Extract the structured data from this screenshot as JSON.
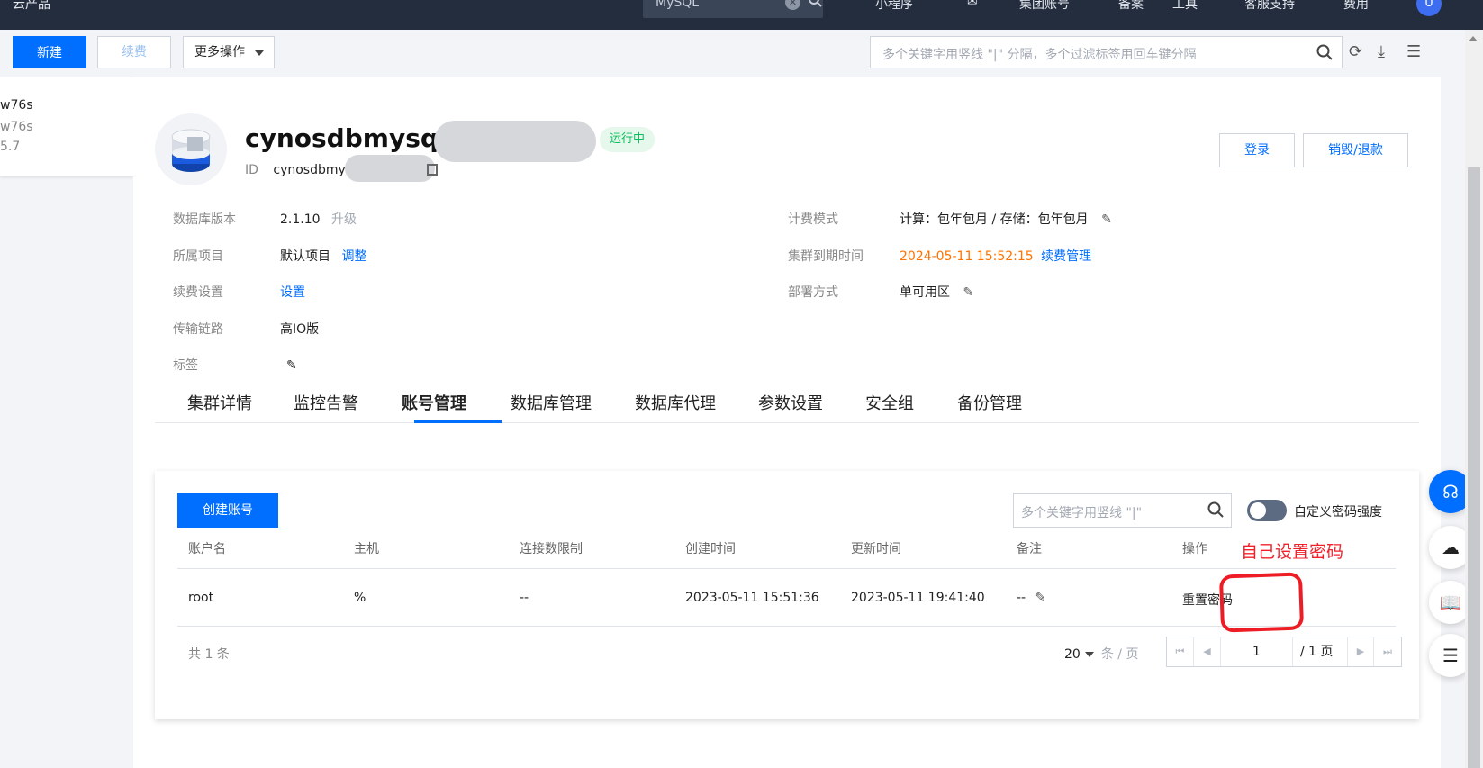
{
  "topbar": {
    "products": "云产品",
    "search_value": "MySQL",
    "items": [
      "小程序",
      "集团账号",
      "备案",
      "工具",
      "客服支持",
      "费用"
    ],
    "avatar": "U"
  },
  "toolbar": {
    "new_label": "新建",
    "renew_label": "续费",
    "more_label": "更多操作",
    "filter_placeholder": "多个关键字用竖线 \"|\" 分隔，多个过滤标签用回车键分隔"
  },
  "left_list": {
    "line1": "w76s",
    "line2": "w76s",
    "line3": "5.7"
  },
  "cluster": {
    "name": "cynosdbmysql",
    "status": "运行中",
    "id_label": "ID",
    "id_value": "cynosdbmysq",
    "login_label": "登录",
    "destroy_label": "销毁/退款"
  },
  "details": {
    "db_version_label": "数据库版本",
    "db_version_value": "2.1.10",
    "upgrade_label": "升级",
    "project_label": "所属项目",
    "project_value": "默认项目",
    "adjust_label": "调整",
    "renew_setting_label": "续费设置",
    "renew_setting_link": "设置",
    "link_label": "传输链路",
    "link_value": "高IO版",
    "tag_label": "标签",
    "billing_label": "计费模式",
    "billing_value": "计算：包年包月 / 存储：包年包月",
    "expire_label": "集群到期时间",
    "expire_value": "2024-05-11 15:52:15",
    "renew_manage_label": "续费管理",
    "deploy_label": "部署方式",
    "deploy_value": "单可用区"
  },
  "tabs": [
    "集群详情",
    "监控告警",
    "账号管理",
    "数据库管理",
    "数据库代理",
    "参数设置",
    "安全组",
    "备份管理"
  ],
  "accounts": {
    "create_label": "创建账号",
    "search_placeholder": "多个关键字用竖线 \"|\"",
    "toggle_label": "自定义密码强度",
    "columns": [
      "账户名",
      "主机",
      "连接数限制",
      "创建时间",
      "更新时间",
      "备注",
      "操作"
    ],
    "rows": [
      {
        "name": "root",
        "host": "%",
        "conn_limit": "--",
        "created": "2023-05-11 15:51:36",
        "updated": "2023-05-11 19:41:40",
        "note": "--",
        "action": "重置密码"
      }
    ],
    "annotation": "自己设置密码",
    "total": "共 1 条",
    "page_size": "20",
    "page_size_unit": "条 / 页",
    "page": "1",
    "page_total": "/ 1 页"
  },
  "colors": {
    "primary": "#006eff",
    "topbar": "#232d3e",
    "running": "#0abf5b",
    "expire": "#ff7200",
    "annotation": "#ee1c25"
  }
}
